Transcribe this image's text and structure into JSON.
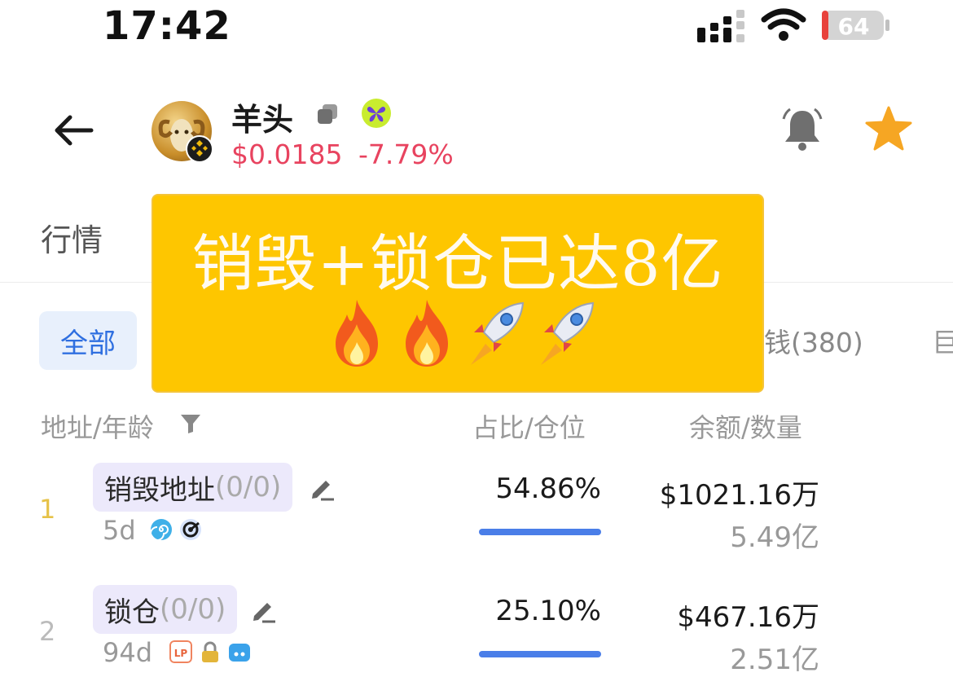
{
  "status_bar": {
    "time": "17:42",
    "battery": "64"
  },
  "token": {
    "name": "羊头",
    "price": "$0.0185",
    "change": "-7.79%",
    "accent_down": "#e8435f",
    "favorite_color": "#f6a623"
  },
  "tabs": {
    "market": "行情"
  },
  "chips": {
    "all": "全部",
    "smart_money": "钱(380)",
    "overflow": "巨"
  },
  "banner": {
    "text": "销毁+锁仓已达8亿",
    "emojis": [
      "fire-icon",
      "fire-icon",
      "rocket-icon",
      "rocket-icon"
    ],
    "background": "#fec600"
  },
  "table": {
    "headers": {
      "address_age": "地址/年龄",
      "share_position": "占比/仓位",
      "balance_quantity": "余额/数量"
    },
    "rows": [
      {
        "rank": "1",
        "label": "销毁地址",
        "label_sub": "(0/0)",
        "age": "5d",
        "tags": [
          "spiral-icon",
          "radar-icon"
        ],
        "share": "54.86%",
        "share_value": 54.86,
        "usd": "$1021.16万",
        "quantity": "5.49亿",
        "rank_color": "#e6c247"
      },
      {
        "rank": "2",
        "label": "锁仓",
        "label_sub": "(0/0)",
        "age": "94d",
        "tags": [
          "lp-icon",
          "lock-icon",
          "controller-icon"
        ],
        "share": "25.10%",
        "share_value": 25.1,
        "usd": "$467.16万",
        "quantity": "2.51亿",
        "rank_color": "#bbbbbb"
      }
    ]
  }
}
